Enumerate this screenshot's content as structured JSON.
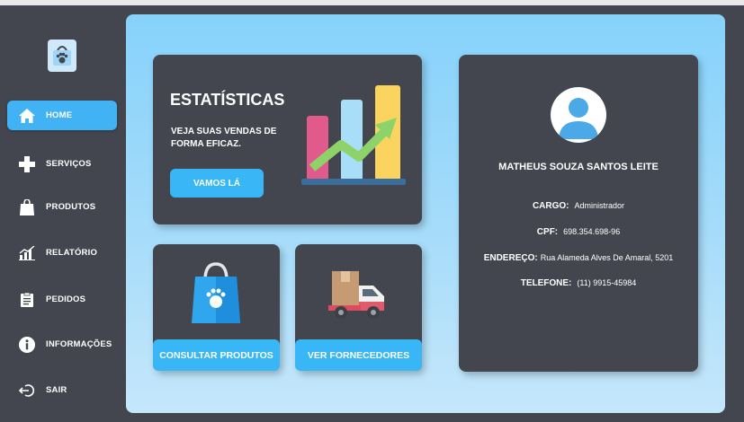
{
  "sidebar": {
    "logo_icon": "paw-bag-icon",
    "items": [
      {
        "label": "HOME",
        "icon": "home-icon",
        "active": true
      },
      {
        "label": "SERVIÇOS",
        "icon": "plus-icon"
      },
      {
        "label": "PRODUTOS",
        "icon": "shopping-bag-icon"
      },
      {
        "label": "RELATÓRIO",
        "icon": "bar-chart-icon"
      },
      {
        "label": "PEDIDOS",
        "icon": "clipboard-icon"
      },
      {
        "label": "INFORMAÇÕES",
        "icon": "info-icon"
      },
      {
        "label": "SAIR",
        "icon": "logout-icon"
      }
    ]
  },
  "stats": {
    "title": "ESTATÍSTICAS",
    "subtitle": "VEJA SUAS VENDAS DE FORMA EFICAZ.",
    "button": "VAMOS LÁ"
  },
  "products": {
    "button": "CONSULTAR PRODUTOS"
  },
  "suppliers": {
    "button": "VER FORNECEDORES"
  },
  "profile": {
    "name": "MATHEUS SOUZA SANTOS LEITE",
    "cargo_label": "CARGO:",
    "cargo": "Administrador",
    "cpf_label": "CPF:",
    "cpf": "698.354.698-96",
    "endereco_label": "ENDEREÇO:",
    "endereco": "Rua Alameda Alves De Amaral, 5201",
    "telefone_label": "TELEFONE:",
    "telefone": "(11) 9915-45984"
  },
  "colors": {
    "accent": "#41b3f5",
    "panel": "#43464f",
    "background_top": "#86d2fb"
  }
}
